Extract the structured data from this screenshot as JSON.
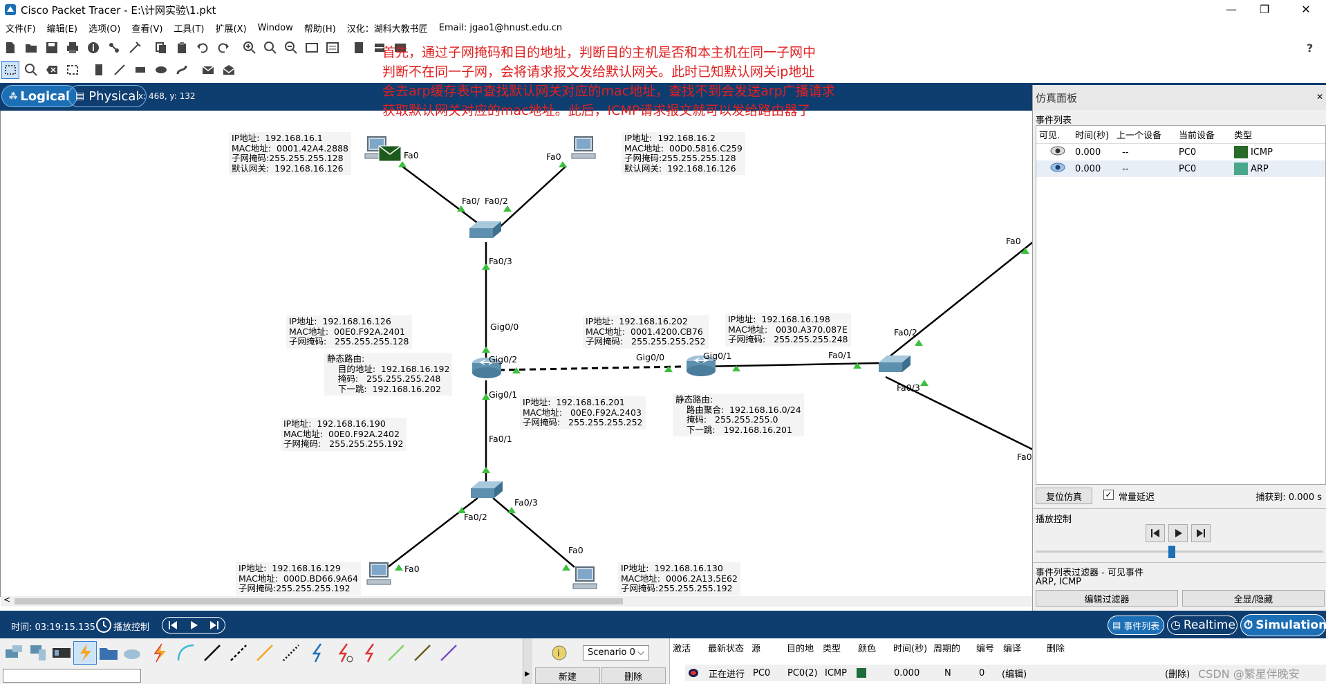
{
  "window": {
    "title": "Cisco Packet Tracer - E:\\计网实验\\1.pkt"
  },
  "menu": [
    "文件(F)",
    "编辑(E)",
    "选项(O)",
    "查看(V)",
    "工具(T)",
    "扩展(X)",
    "Window",
    "帮助(H)",
    "汉化：湖科大教书匠",
    "Email: jgao1@hnust.edu.cn"
  ],
  "workspace": {
    "logical_label": "Logical",
    "physical_label": "Physical",
    "coords": "x: 468, y: 132"
  },
  "overlay_text": [
    "首先，通过子网掩码和目的地址，判断目的主机是否和本主机在同一子网中",
    "判断不在同一子网，会将请求报文发给默认网关。此时已知默认网关ip地址",
    "会去arp缓存表中查找默认网关对应的mac地址，查找不到会发送arp广播请求",
    "获取默认网关对应的mac地址。此后，ICMP请求报文就可以发给路由器了"
  ],
  "notes": {
    "pc0": "IP地址:  192.168.16.1\nMAC地址:  0001.42A4.2888\n子网掩码:255.255.255.128\n默认网关:  192.168.16.126",
    "pc1": "IP地址:  192.168.16.2\nMAC地址:  00D0.5816.C259\n子网掩码:255.255.255.128\n默认网关:  192.168.16.126",
    "r0_g00": "IP地址:  192.168.16.126\nMAC地址:  00E0.F92A.2401\n子网掩码:   255.255.255.128",
    "r0_static": "静态路由:\n    目的地址:  192.168.16.192\n    掩码:   255.255.255.248\n    下一跳:  192.168.16.202",
    "r1_g00": "IP地址:  192.168.16.202\nMAC地址:  0001.4200.CB76\n子网掩码:   255.255.255.252",
    "r1_g01": "IP地址:  192.168.16.198\nMAC地址:   0030.A370.087E\n子网掩码:   255.255.255.248",
    "r0_g02": "IP地址:  192.168.16.201\nMAC地址:   00E0.F92A.2403\n子网掩码:   255.255.255.252",
    "r1_static": "静态路由:\n    路由聚合:  192.168.16.0/24\n    掩码:   255.255.255.0\n    下一跳:   192.168.16.201",
    "r0_g01": "IP地址:  192.168.16.190\nMAC地址:  00E0.F92A.2402\n子网掩码:   255.255.255.192",
    "pc2": "IP地址:  192.168.16.129\nMAC地址:  000D.BD66.9A64\n子网掩码:255.255.255.192",
    "pc3": "IP地址:  192.168.16.130\nMAC地址:  0006.2A13.5E62\n子网掩码:255.255.255.192"
  },
  "ports": {
    "pc0_fa0": "Fa0",
    "pc1_fa0": "Fa0",
    "sw0_fa01": "Fa0/",
    "sw0_fa02": "Fa0/2",
    "sw0_fa03": "Fa0/3",
    "r0_g00": "Gig0/0",
    "r0_g02": "Gig0/2",
    "r0_g01": "Gig0/1",
    "r1_g00": "Gig0/0",
    "r1_g01": "Gig0/1",
    "sw2_fa01": "Fa0/1",
    "sw2_fa02": "Fa0/2",
    "sw2_fa03": "Fa0/3",
    "right_fa0_top": "Fa0",
    "right_fa0_bottom": "Fa0",
    "sw1_fa01": "Fa0/1",
    "sw1_fa02": "Fa0/2",
    "sw1_fa03": "Fa0/3",
    "pc2_fa0": "Fa0",
    "pc3_fa0": "Fa0"
  },
  "sim_panel": {
    "title": "仿真面板",
    "event_list_label": "事件列表",
    "columns": [
      "可见.",
      "时间(秒)",
      "上一个设备",
      "当前设备",
      "类型"
    ],
    "events": [
      {
        "time": "0.000",
        "last": "--",
        "at": "PC0",
        "type": "ICMP",
        "color": "#2a6b2a"
      },
      {
        "time": "0.000",
        "last": "--",
        "at": "PC0",
        "type": "ARP",
        "color": "#4aa88a"
      }
    ],
    "reset_label": "复位仿真",
    "constant_delay_label": "常量延迟",
    "captured_label": "捕获到:  0.000 s",
    "play_controls_label": "播放控制",
    "filter_title": "事件列表过滤器 - 可见事件",
    "filter_value": "ARP, ICMP",
    "edit_filter_label": "编辑过滤器",
    "show_all_label": "全显/隐藏"
  },
  "bottom_bar": {
    "time_label": "时间: 03:19:15.135",
    "play_label": "播放控制",
    "event_list_btn": "事件列表",
    "realtime_btn": "Realtime",
    "simulation_btn": "Simulation"
  },
  "scenario": {
    "selected": "Scenario 0",
    "new_label": "新建",
    "delete_label": "删除"
  },
  "pdu_table": {
    "columns": [
      "激活",
      "最新状态",
      "源",
      "目的地",
      "类型",
      "颜色",
      "时间(秒)",
      "周期的",
      "编号",
      "编译",
      "删除"
    ],
    "row": {
      "status": "正在进行",
      "src": "PC0",
      "dst": "PC0(2)",
      "type": "ICMP",
      "time": "0.000",
      "periodic": "N",
      "num": "0",
      "edit": "(编辑)",
      "del": "(删除)"
    }
  },
  "watermark": "CSDN @繁星伴晚安"
}
